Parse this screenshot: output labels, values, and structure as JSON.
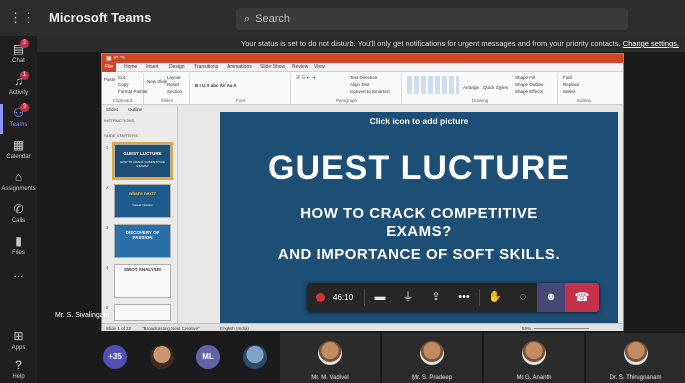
{
  "app": {
    "name": "Microsoft Teams"
  },
  "search": {
    "placeholder": "Search"
  },
  "rail": {
    "items": [
      {
        "label": "Chat",
        "icon": "chat-icon",
        "badge": "2"
      },
      {
        "label": "Activity",
        "icon": "bell-icon",
        "badge": "1"
      },
      {
        "label": "Teams",
        "icon": "teams-icon",
        "badge": "3"
      },
      {
        "label": "Calendar",
        "icon": "calendar-icon"
      },
      {
        "label": "Assignments",
        "icon": "assignments-icon"
      },
      {
        "label": "Calls",
        "icon": "phone-icon"
      },
      {
        "label": "Files",
        "icon": "file-icon"
      },
      {
        "label": "...",
        "icon": "more-icon"
      },
      {
        "label": "Apps",
        "icon": "apps-icon"
      },
      {
        "label": "Help",
        "icon": "help-icon"
      }
    ]
  },
  "banner": {
    "text": "Your status is set to do not disturb. You'll only get notifications for urgent messages and from your priority contacts.",
    "link": "Change settings."
  },
  "ppt": {
    "tabs": [
      "File",
      "Home",
      "Insert",
      "Design",
      "Transitions",
      "Animations",
      "Slide Show",
      "Review",
      "View"
    ],
    "ribbon_groups": [
      "Clipboard",
      "Slides",
      "Font",
      "Paragraph",
      "Drawing",
      "Editing"
    ],
    "ribbon_cmds": {
      "cut": "Cut",
      "copy": "Copy",
      "format_painter": "Format Painter",
      "layout": "Layout",
      "reset": "Reset",
      "section": "Section",
      "arrange": "Arrange",
      "quick_styles": "Quick Styles",
      "shape_fill": "Shape Fill",
      "shape_outline": "Shape Outline",
      "shape_effects": "Shape Effects",
      "find": "Find",
      "replace": "Replace",
      "select": "Select",
      "text_direction": "Text Direction",
      "align_text": "Align Text",
      "convert": "Convert to SmartArt",
      "new_slide": "New Slide",
      "paste": "Paste"
    },
    "panel_tabs": [
      "Slides",
      "Outline"
    ],
    "sections": [
      "INSTRUCTIONS",
      "SLIDE STARTERS"
    ],
    "thumbs": [
      {
        "num": "1",
        "title": "GUEST LUCTURE",
        "sub": "HOW TO CRACK COMPETITIVE EXAMS?"
      },
      {
        "num": "2",
        "title": "what's next?",
        "sub": "Career Options"
      },
      {
        "num": "3",
        "title": "DISCOVERY OF PASSION",
        "sub": ""
      },
      {
        "num": "4",
        "title": "SWOT ANALYSIS",
        "sub": ""
      },
      {
        "num": "5",
        "title": "",
        "sub": ""
      }
    ],
    "slide": {
      "placeholder": "Click icon to add picture",
      "title": "GUEST LUCTURE",
      "line1": "HOW TO CRACK COMPETITIVE",
      "line2": "EXAMS?",
      "line3": "AND IMPORTANCE OF SOFT SKILLS."
    },
    "status": {
      "slide": "Slide 1 of 22",
      "theme": "\"Broadcasting Next Creative\"",
      "language": "English (India)",
      "zoom": "59%"
    }
  },
  "presenter": {
    "name": "Mr. S. Sivalingam"
  },
  "controls": {
    "timer": "46:10",
    "buttons": [
      "camera-off-icon",
      "mic-off-icon",
      "share-icon",
      "more-icon",
      "raise-hand-icon",
      "chat-icon",
      "people-icon",
      "hang-up-icon"
    ]
  },
  "participants": {
    "overflow": "+35",
    "initials": "ML",
    "tiles": [
      {
        "name": "Mr. M. Vadivel"
      },
      {
        "name": "Mr. S. Pradeep"
      },
      {
        "name": "Mr.G. Ananth"
      },
      {
        "name": "Dr. S. Thirugnanam"
      }
    ]
  },
  "colors": {
    "accent": "#8f92ff",
    "hangup": "#c4314b",
    "slide_bg": "#1d4e76",
    "ppt_brand": "#d14424"
  }
}
